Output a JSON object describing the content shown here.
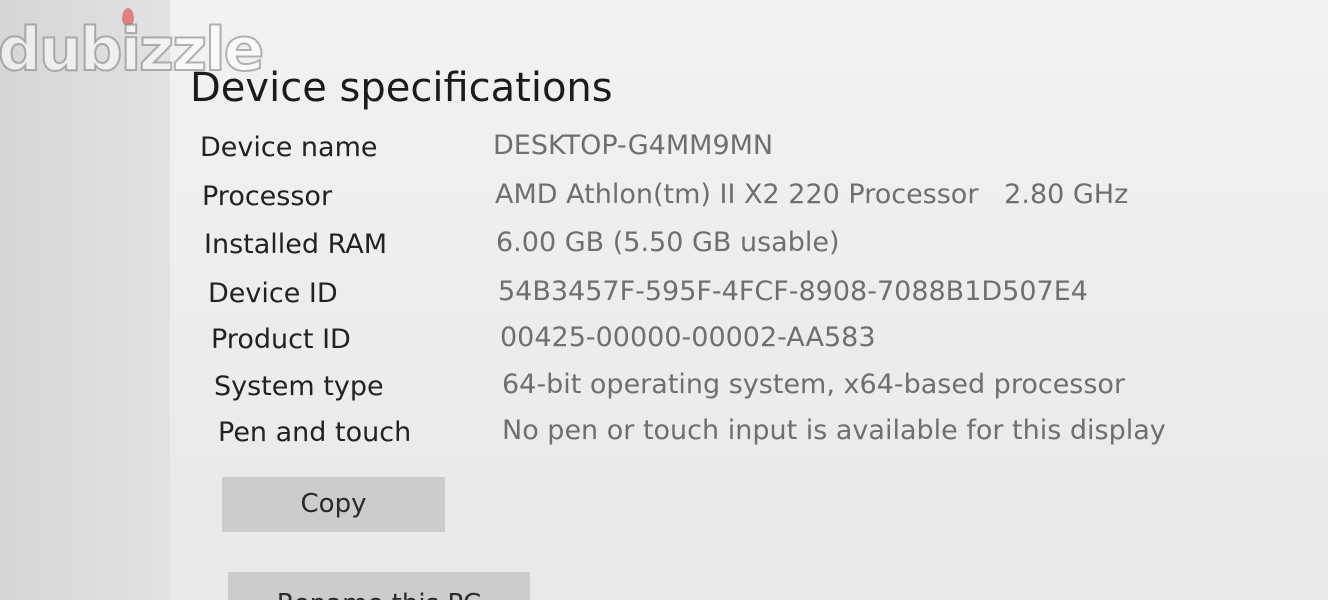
{
  "watermark": {
    "text": "dubizzle"
  },
  "page": {
    "title": "Device specifications"
  },
  "specs": [
    {
      "label": "Device name",
      "value": "DESKTOP-G4MM9MN"
    },
    {
      "label": "Processor",
      "value": "AMD Athlon(tm) II X2 220 Processor   2.80 GHz"
    },
    {
      "label": "Installed RAM",
      "value": "6.00 GB (5.50 GB usable)"
    },
    {
      "label": "Device ID",
      "value": "54B3457F-595F-4FCF-8908-7088B1D507E4"
    },
    {
      "label": "Product ID",
      "value": "00425-00000-00002-AA583"
    },
    {
      "label": "System type",
      "value": "64-bit operating system, x64-based processor"
    },
    {
      "label": "Pen and touch",
      "value": "No pen or touch input is available for this display"
    }
  ],
  "buttons": {
    "copy_label": "Copy",
    "rename_label": "Rename this PC"
  }
}
